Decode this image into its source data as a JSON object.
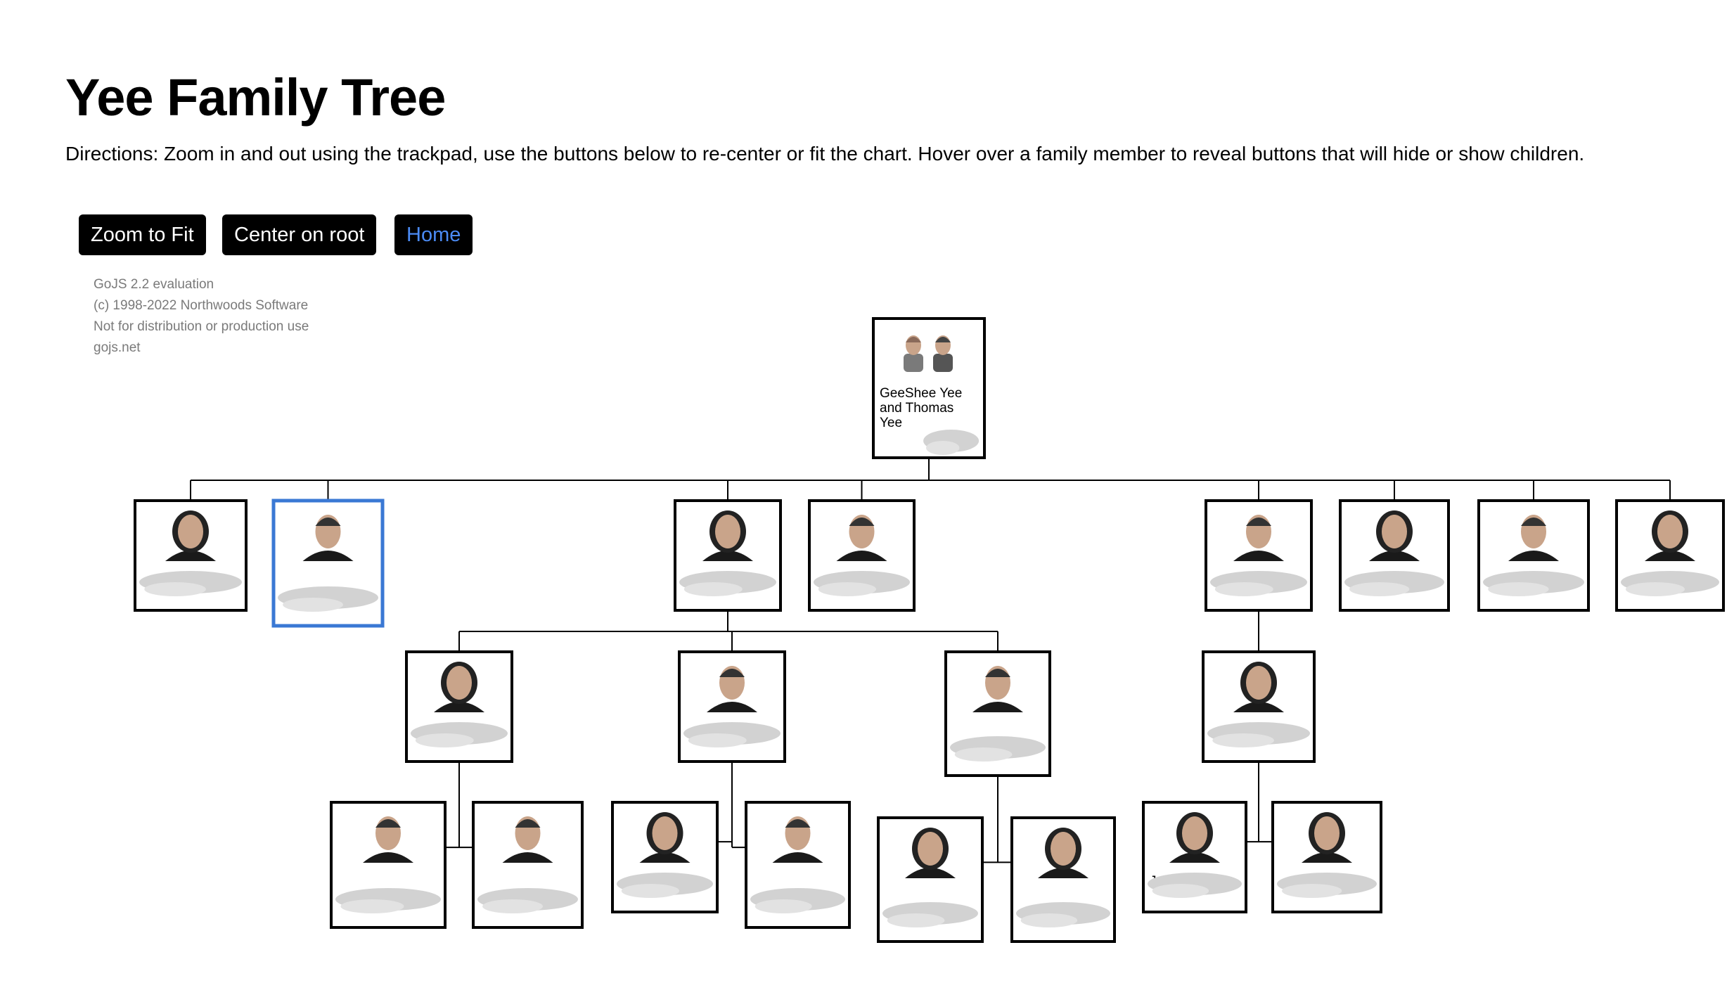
{
  "page": {
    "title": "Yee Family Tree",
    "directions": "Directions: Zoom in and out using the trackpad, use the buttons below to re-center or fit the chart. Hover over a family member to reveal buttons that will hide or show children."
  },
  "toolbar": {
    "zoom_fit_label": "Zoom to Fit",
    "center_root_label": "Center on root",
    "home_label": "Home"
  },
  "watermark": {
    "line1": "GoJS 2.2 evaluation",
    "line2": "(c) 1998-2022 Northwoods Software",
    "line3": "Not for distribution or production use",
    "line4": "gojs.net"
  },
  "tree": {
    "root": {
      "name": "GeeShee Yee\nand Thomas\nYee",
      "photo": "couple-photo-icon"
    },
    "level1": [
      {
        "name": "",
        "photo": "woman-portrait-icon"
      },
      {
        "name": "",
        "photo": "man-portrait-icon",
        "selected": true
      },
      {
        "name": "",
        "photo": "woman-portrait-icon"
      },
      {
        "name": "",
        "photo": "man-portrait-icon"
      },
      {
        "name": "",
        "photo": "man-portrait-icon"
      },
      {
        "name": "",
        "photo": "woman-portrait-icon"
      },
      {
        "name": "",
        "photo": "man-portrait-icon"
      },
      {
        "name": "",
        "photo": "woman-portrait-icon"
      }
    ],
    "level2": [
      {
        "name": "",
        "photo": "woman-portrait-icon"
      },
      {
        "name": "",
        "photo": "man-portrait-icon"
      },
      {
        "name": "",
        "photo": "man-portrait-icon"
      },
      {
        "name": "",
        "photo": "woman-portrait-icon"
      }
    ],
    "level3": [
      {
        "name": "",
        "photo": "man-portrait-icon"
      },
      {
        "name": "",
        "photo": "man-portrait-icon"
      },
      {
        "name": "",
        "photo": "woman-portrait-icon"
      },
      {
        "name": "",
        "photo": "man-portrait-icon"
      },
      {
        "name": "",
        "photo": "woman-portrait-icon"
      },
      {
        "name": "",
        "photo": "woman-portrait-icon"
      },
      {
        "name": "Julia Grimes",
        "photo": "woman-portrait-icon"
      },
      {
        "name": "",
        "photo": "woman-portrait-icon"
      }
    ]
  }
}
